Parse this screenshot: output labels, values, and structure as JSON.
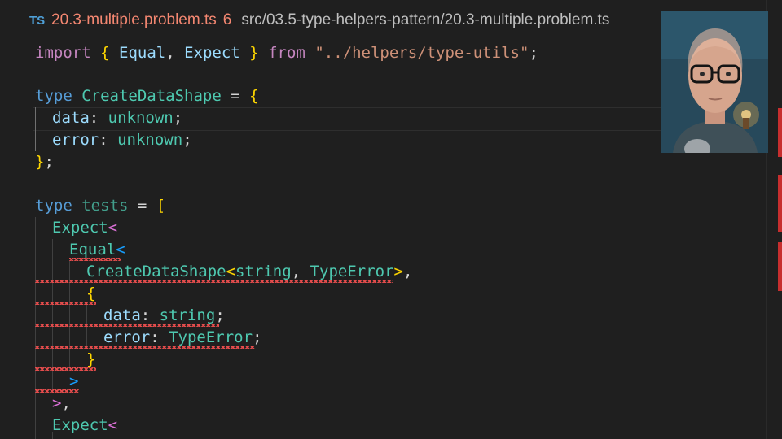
{
  "tab": {
    "badge": "TS",
    "filename": "20.3-multiple.problem.ts",
    "error_count": "6",
    "path": "src/03.5-type-helpers-pattern/20.3-multiple.problem.ts"
  },
  "code": {
    "l1": {
      "kw": "import",
      "ob": "{",
      "a": "Equal",
      "comma": ",",
      "b": "Expect",
      "cb": "}",
      "from": "from",
      "str": "\"../helpers/type-utils\"",
      "semi": ";"
    },
    "l3": {
      "kw": "type",
      "name": "CreateDataShape",
      "eq": "=",
      "ob": "{"
    },
    "l4": {
      "prop": "data",
      "colon": ":",
      "type": "unknown",
      "semi": ";"
    },
    "l5": {
      "prop": "error",
      "colon": ":",
      "type": "unknown",
      "semi": ";"
    },
    "l6": {
      "cb": "}",
      "semi": ";"
    },
    "l8": {
      "kw": "type",
      "name": "tests",
      "eq": "=",
      "ob": "["
    },
    "l9": {
      "name": "Expect",
      "lt": "<"
    },
    "l10": {
      "name": "Equal",
      "lt": "<"
    },
    "l11": {
      "name": "CreateDataShape",
      "lt": "<",
      "a": "string",
      "comma": ",",
      "b": "TypeError",
      "gt": ">",
      "end": ","
    },
    "l12": {
      "ob": "{"
    },
    "l13": {
      "prop": "data",
      "colon": ":",
      "type": "string",
      "semi": ";"
    },
    "l14": {
      "prop": "error",
      "colon": ":",
      "type": "TypeError",
      "semi": ";"
    },
    "l15": {
      "cb": "}"
    },
    "l16": {
      "gt": ">"
    },
    "l17": {
      "gt": ">",
      "comma": ","
    },
    "l18": {
      "name": "Expect",
      "lt": "<"
    }
  },
  "colors": {
    "background": "#1f1f1f",
    "error": "#e34c4c",
    "keyword": "#569cd6",
    "type": "#4ec9b0",
    "string": "#ce9178"
  }
}
